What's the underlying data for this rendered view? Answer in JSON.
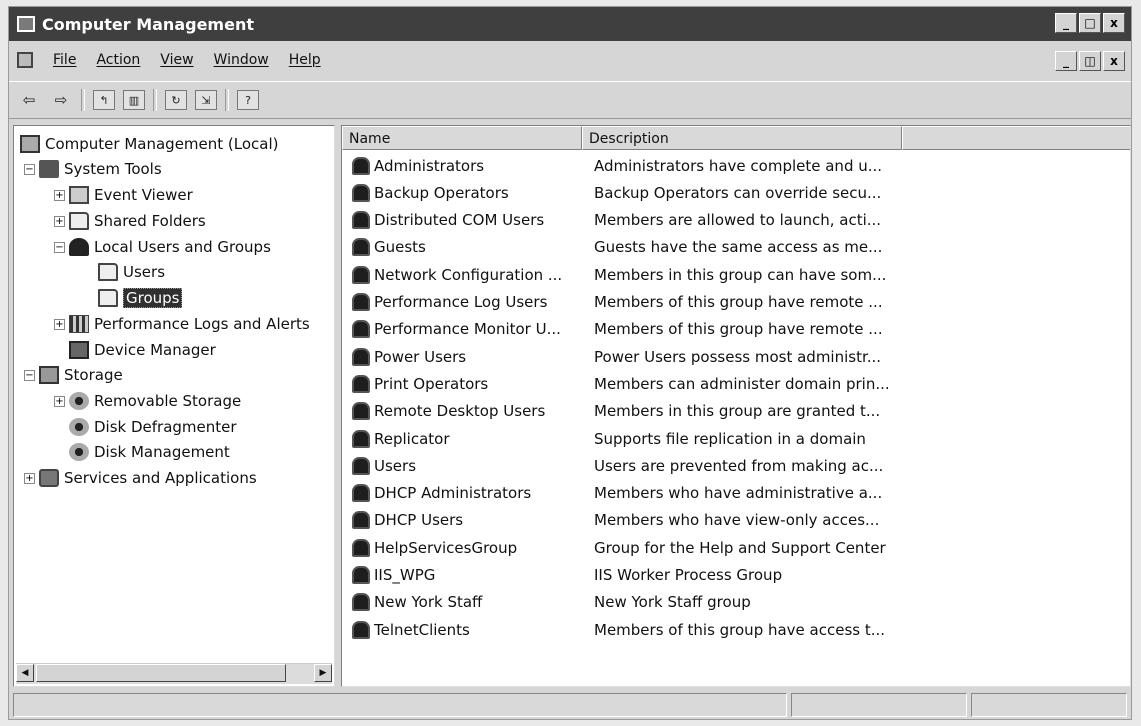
{
  "window": {
    "title": "Computer Management",
    "buttons": {
      "minimize": "_",
      "maximize": "□",
      "close": "x"
    }
  },
  "menu": {
    "items": [
      "File",
      "Action",
      "View",
      "Window",
      "Help"
    ],
    "mdi_buttons": {
      "minimize": "_",
      "restore": "◫",
      "close": "x"
    }
  },
  "toolbar": {
    "icons": [
      "back-icon",
      "forward-icon",
      "up-icon",
      "show-tree-icon",
      "refresh-icon",
      "export-icon",
      "help-icon"
    ]
  },
  "tree": {
    "root": "Computer Management (Local)",
    "system_tools": "System Tools",
    "event_viewer": "Event Viewer",
    "shared_folders": "Shared Folders",
    "local_users": "Local Users and Groups",
    "users": "Users",
    "groups": "Groups",
    "perf_logs": "Performance Logs and Alerts",
    "device_manager": "Device Manager",
    "storage": "Storage",
    "removable": "Removable Storage",
    "defrag": "Disk Defragmenter",
    "disk_mgmt": "Disk Management",
    "services": "Services and Applications",
    "expanders": {
      "plus": "+",
      "minus": "−"
    }
  },
  "list": {
    "columns": [
      "Name",
      "Description"
    ],
    "rows": [
      {
        "name": "Administrators",
        "desc": "Administrators have complete and u..."
      },
      {
        "name": "Backup Operators",
        "desc": "Backup Operators can override secu..."
      },
      {
        "name": "Distributed COM Users",
        "desc": "Members are allowed to launch, acti..."
      },
      {
        "name": "Guests",
        "desc": "Guests have the same access as me..."
      },
      {
        "name": "Network Configuration ...",
        "desc": "Members in this group can have som..."
      },
      {
        "name": "Performance Log Users",
        "desc": "Members of this group have remote ..."
      },
      {
        "name": "Performance Monitor U...",
        "desc": "Members of this group have remote ..."
      },
      {
        "name": "Power Users",
        "desc": "Power Users possess most administr..."
      },
      {
        "name": "Print Operators",
        "desc": "Members can administer domain prin..."
      },
      {
        "name": "Remote Desktop Users",
        "desc": "Members in this group are granted t..."
      },
      {
        "name": "Replicator",
        "desc": "Supports file replication in a domain"
      },
      {
        "name": "Users",
        "desc": "Users are prevented from making ac..."
      },
      {
        "name": "DHCP Administrators",
        "desc": "Members who have administrative a..."
      },
      {
        "name": "DHCP Users",
        "desc": "Members who have view-only acces..."
      },
      {
        "name": "HelpServicesGroup",
        "desc": "Group for the Help and Support Center"
      },
      {
        "name": "IIS_WPG",
        "desc": "IIS Worker Process Group"
      },
      {
        "name": "New York Staff",
        "desc": "New York Staff group"
      },
      {
        "name": "TelnetClients",
        "desc": "Members of this group have access t..."
      }
    ]
  },
  "scroll": {
    "left_arrow": "◀",
    "right_arrow": "▶"
  }
}
